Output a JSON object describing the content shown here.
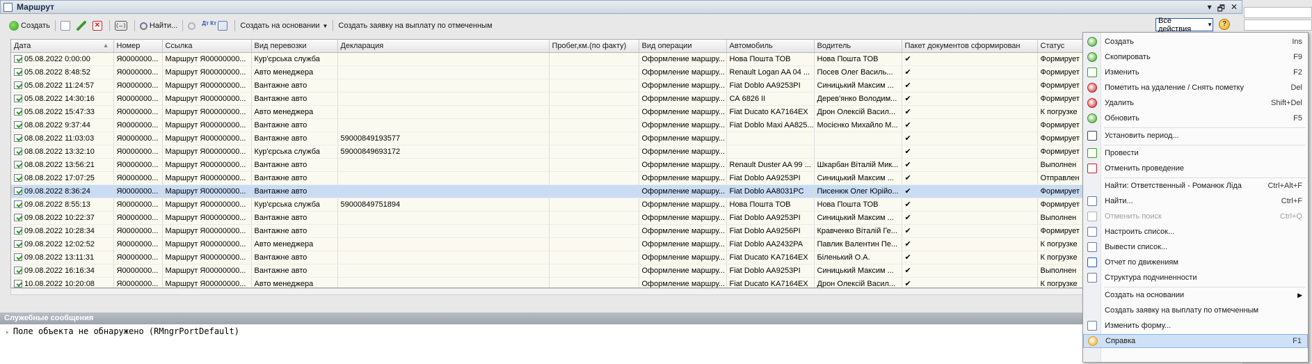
{
  "window": {
    "title": "Маршрут",
    "btn_menu": "▾",
    "btn_restore": "🗗",
    "btn_close": "✕"
  },
  "toolbar": {
    "create": "Создать",
    "find": "Найти...",
    "create_based": "Создать на основании",
    "create_request": "Создать заявку на выплату по отмеченным",
    "all_actions": "Все действия",
    "help_glyph": "?",
    "dt_glyph": "Дт Кт",
    "period_glyph": "(↔)",
    "delete_glyph": "✕"
  },
  "columns": [
    "Дата",
    "Номер",
    "Ссылка",
    "Вид перевозки",
    "Декларация",
    "Пробег,км.(по факту)",
    "Вид операции",
    "Автомобиль",
    "Водитель",
    "Пакет документов сформирован",
    "Статус"
  ],
  "sort_glyph": "▲",
  "rows": [
    {
      "date": "05.08.2022 0:00:00",
      "num": "Я0000000...",
      "link": "Маршрут Я00000000...",
      "kind": "Кур'єрська служба",
      "decl": "",
      "run": "",
      "op": "Оформление маршру...",
      "car": "Нова Пошта ТОВ",
      "driver": "Нова Пошта ТОВ",
      "pack": "✔",
      "status": "Формирует"
    },
    {
      "date": "05.08.2022 8:48:52",
      "num": "Я0000000...",
      "link": "Маршрут Я00000000...",
      "kind": "Авто менеджера",
      "decl": "",
      "run": "",
      "op": "Оформление маршру...",
      "car": "Renault Logan AA 04 ...",
      "driver": "Посев Олег Василь...",
      "pack": "✔",
      "status": "Формирует"
    },
    {
      "date": "05.08.2022 11:24:57",
      "num": "Я0000000...",
      "link": "Маршрут Я00000000...",
      "kind": "Вантажне авто",
      "decl": "",
      "run": "",
      "op": "Оформление маршру...",
      "car": "Fiat Doblo AA9253PI",
      "driver": "Синицький Максим ...",
      "pack": "✔",
      "status": "Формирует"
    },
    {
      "date": "05.08.2022 14:30:16",
      "num": "Я0000000...",
      "link": "Маршрут Я00000000...",
      "kind": "Вантажне авто",
      "decl": "",
      "run": "",
      "op": "Оформление маршру...",
      "car": "СА 6826 II",
      "driver": "Дерев'янко Володим...",
      "pack": "✔",
      "status": "Формирует"
    },
    {
      "date": "05.08.2022 15:47:33",
      "num": "Я0000000...",
      "link": "Маршрут Я00000000...",
      "kind": "Авто менеджера",
      "decl": "",
      "run": "",
      "op": "Оформление маршру...",
      "car": "Fiat Ducato KA7164EX",
      "driver": "Дрон Олексій Васил...",
      "pack": "✔",
      "status": "К погрузке"
    },
    {
      "date": "08.08.2022 9:37:44",
      "num": "Я0000000...",
      "link": "Маршрут Я00000000...",
      "kind": "Вантажне авто",
      "decl": "",
      "run": "",
      "op": "Оформление маршру...",
      "car": "Fiat Doblo Maxi AA825...",
      "driver": "Мосієнко Михайло М...",
      "pack": "✔",
      "status": "Формирует"
    },
    {
      "date": "08.08.2022 11:03:03",
      "num": "Я0000000...",
      "link": "Маршрут Я00000000...",
      "kind": "Вантажне авто",
      "decl": "59000849193577",
      "run": "",
      "op": "Оформление маршру...",
      "car": "",
      "driver": "",
      "pack": "✔",
      "status": "Формирует"
    },
    {
      "date": "08.08.2022 13:32:10",
      "num": "Я0000000...",
      "link": "Маршрут Я00000000...",
      "kind": "Кур'єрська служба",
      "decl": "59000849693172",
      "run": "",
      "op": "Оформление маршру...",
      "car": "",
      "driver": "",
      "pack": "✔",
      "status": "Формирует"
    },
    {
      "date": "08.08.2022 13:56:21",
      "num": "Я0000000...",
      "link": "Маршрут Я00000000...",
      "kind": "Вантажне авто",
      "decl": "",
      "run": "",
      "op": "Оформление маршру...",
      "car": "Renault Duster AA 99 ...",
      "driver": "Шкарбан Віталій Мик...",
      "pack": "✔",
      "status": "Выполнен"
    },
    {
      "date": "08.08.2022 17:07:25",
      "num": "Я0000000...",
      "link": "Маршрут Я00000000...",
      "kind": "Вантажне авто",
      "decl": "",
      "run": "",
      "op": "Оформление маршру...",
      "car": "Fiat Doblo AA9253PI",
      "driver": "Синицький Максим ...",
      "pack": "✔",
      "status": "Отправлен"
    },
    {
      "date": "09.08.2022 8:36:24",
      "num": "Я0000000...",
      "link": "Маршрут Я00000000...",
      "kind": "Вантажне авто",
      "decl": "",
      "run": "",
      "op": "Оформление маршру...",
      "car": "Fiat Doblo AA8031PC",
      "driver": "Писенюк Олег Юрійо...",
      "pack": "✔",
      "status": "Формирует",
      "selected": true
    },
    {
      "date": "09.08.2022 8:55:13",
      "num": "Я0000000...",
      "link": "Маршрут Я00000000...",
      "kind": "Кур'єрська служба",
      "decl": "59000849751894",
      "run": "",
      "op": "Оформление маршру...",
      "car": "Нова Пошта ТОВ",
      "driver": "Нова Пошта ТОВ",
      "pack": "✔",
      "status": "Формирует"
    },
    {
      "date": "09.08.2022 10:22:37",
      "num": "Я0000000...",
      "link": "Маршрут Я00000000...",
      "kind": "Вантажне авто",
      "decl": "",
      "run": "",
      "op": "Оформление маршру...",
      "car": "Fiat Doblo AA9253PI",
      "driver": "Синицький Максим ...",
      "pack": "✔",
      "status": "Выполнен"
    },
    {
      "date": "09.08.2022 10:28:34",
      "num": "Я0000000...",
      "link": "Маршрут Я00000000...",
      "kind": "Вантажне авто",
      "decl": "",
      "run": "",
      "op": "Оформление маршру...",
      "car": "Fiat Doblo AA9256PI",
      "driver": "Кравченко Віталій Ге...",
      "pack": "✔",
      "status": "Формирует"
    },
    {
      "date": "09.08.2022 12:02:52",
      "num": "Я0000000...",
      "link": "Маршрут Я00000000...",
      "kind": "Авто менеджера",
      "decl": "",
      "run": "",
      "op": "Оформление маршру...",
      "car": "Fiat Doblo AA2432PA",
      "driver": "Павлик Валентин Пе...",
      "pack": "✔",
      "status": "К погрузке"
    },
    {
      "date": "09.08.2022 13:11:31",
      "num": "Я0000000...",
      "link": "Маршрут Я00000000...",
      "kind": "Вантажне авто",
      "decl": "",
      "run": "",
      "op": "Оформление маршру...",
      "car": "Fiat Ducato KA7164EX",
      "driver": "Біленький О.А.",
      "pack": "✔",
      "status": "К погрузке"
    },
    {
      "date": "09.08.2022 16:16:34",
      "num": "Я0000000...",
      "link": "Маршрут Я00000000...",
      "kind": "Вантажне авто",
      "decl": "",
      "run": "",
      "op": "Оформление маршру...",
      "car": "Fiat Doblo AA9253PI",
      "driver": "Синицький Максим ...",
      "pack": "✔",
      "status": "Выполнен"
    },
    {
      "date": "10.08.2022 10:20:08",
      "num": "Я0000000...",
      "link": "Маршрут Я00000000...",
      "kind": "Авто менеджера",
      "decl": "",
      "run": "",
      "op": "Оформление маршру...",
      "car": "Fiat Ducato KA7164EX",
      "driver": "Дрон Олексій Васил...",
      "pack": "✔",
      "status": "К погрузке"
    }
  ],
  "messages": {
    "header": "Служебные сообщения",
    "text": "Поле объекта не обнаружено (RMngrPortDefault)"
  },
  "menu": [
    {
      "label": "Создать",
      "key": "Ins",
      "icon": "create-icon",
      "color": "#3a9d23"
    },
    {
      "label": "Скопировать",
      "key": "F9",
      "icon": "copy-icon",
      "color": "#3a9d23"
    },
    {
      "label": "Изменить",
      "key": "F2",
      "icon": "edit-icon",
      "color": "#3a9d23"
    },
    {
      "label": "Пометить на удаление / Снять пометку",
      "key": "Del",
      "icon": "mark-delete-icon",
      "color": "#c62020"
    },
    {
      "label": "Удалить",
      "key": "Shift+Del",
      "icon": "delete-icon",
      "color": "#c62020"
    },
    {
      "label": "Обновить",
      "key": "F5",
      "icon": "refresh-icon",
      "color": "#3a9d23"
    },
    {
      "label": "Установить период...",
      "key": "",
      "icon": "period-icon",
      "color": "#444"
    },
    {
      "label": "Провести",
      "key": "",
      "icon": "post-icon",
      "color": "#3a9d23"
    },
    {
      "label": "Отменить проведение",
      "key": "",
      "icon": "unpost-icon",
      "color": "#c62020"
    },
    {
      "label": "Найти: Ответственный - Романюк Ліда",
      "key": "Ctrl+Alt+F",
      "icon": "",
      "color": ""
    },
    {
      "label": "Найти...",
      "key": "Ctrl+F",
      "icon": "find-icon",
      "color": "#6b7a93"
    },
    {
      "label": "Отменить поиск",
      "key": "Ctrl+Q",
      "icon": "cancel-find-icon",
      "color": "#b0b0b0",
      "disabled": true
    },
    {
      "label": "Настроить список...",
      "key": "",
      "icon": "list-settings-icon",
      "color": "#6a7d9c"
    },
    {
      "label": "Вывести список...",
      "key": "",
      "icon": "output-list-icon",
      "color": "#6a7d9c"
    },
    {
      "label": "Отчет по движениям",
      "key": "",
      "icon": "dt-kt-icon",
      "color": "#2358b8"
    },
    {
      "label": "Структура подчиненности",
      "key": "",
      "icon": "structure-icon",
      "color": "#6a7d9c"
    },
    {
      "label": "Создать на основании",
      "key": "",
      "icon": "",
      "color": "",
      "submenu": true
    },
    {
      "label": "Создать заявку на выплату по отмеченным",
      "key": "",
      "icon": "",
      "color": ""
    },
    {
      "label": "Изменить форму...",
      "key": "",
      "icon": "change-form-icon",
      "color": "#6a7d9c"
    },
    {
      "label": "Справка",
      "key": "F1",
      "icon": "help-icon",
      "color": "#e3a514",
      "highlight": true
    }
  ]
}
